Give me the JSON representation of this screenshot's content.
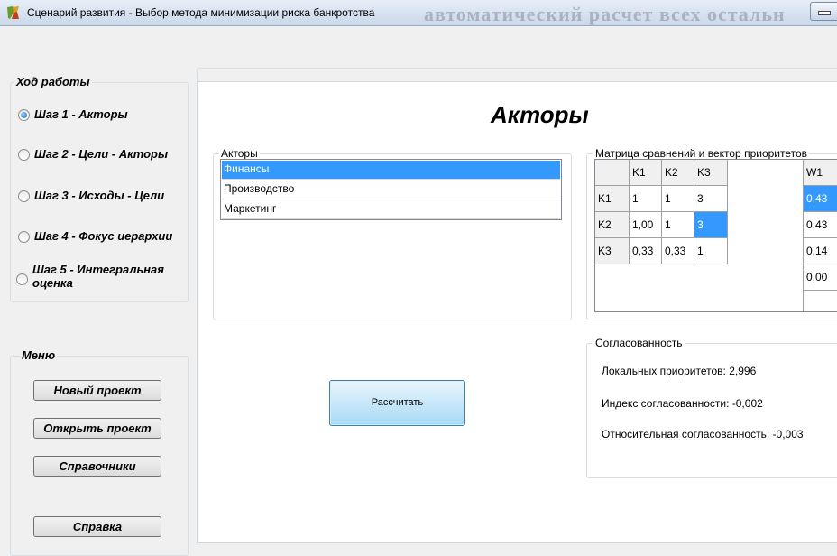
{
  "window": {
    "title": "Сценарий развития - Выбор метода минимизации риска банкротства",
    "ghost_text": "автоматический расчет всех остальн"
  },
  "workflow": {
    "legend": "Ход работы",
    "steps": [
      {
        "label": "Шаг 1 - Акторы",
        "checked": true
      },
      {
        "label": "Шаг 2 - Цели - Акторы",
        "checked": false
      },
      {
        "label": "Шаг 3 - Исходы - Цели",
        "checked": false
      },
      {
        "label": "Шаг 4 - Фокус иерархии",
        "checked": false
      },
      {
        "label": "Шаг 5 - Интегральная оценка",
        "checked": false
      }
    ]
  },
  "menu": {
    "legend": "Меню",
    "new_project": "Новый проект",
    "open_project": "Открыть проект",
    "references": "Справочники",
    "help": "Справка"
  },
  "main": {
    "title": "Акторы",
    "actors": {
      "legend": "Акторы",
      "items": [
        "Финансы",
        "Производство",
        "Маркетинг"
      ],
      "selected_index": 0
    },
    "matrix": {
      "legend": "Матрица сравнений  и вектор приоритетов",
      "columns": [
        "K1",
        "K2",
        "K3"
      ],
      "rows": [
        {
          "label": "K1",
          "values": [
            "1",
            "1",
            "3"
          ]
        },
        {
          "label": "K2",
          "values": [
            "1,00",
            "1",
            "3"
          ]
        },
        {
          "label": "K3",
          "values": [
            "0,33",
            "0,33",
            "1"
          ]
        }
      ],
      "weights_header": "W1",
      "weights": [
        "0,43",
        "0,43",
        "0,14",
        "0,00"
      ]
    },
    "calculate_button": "Рассчитать",
    "consistency": {
      "legend": "Согласованность",
      "local_priorities": "Локальных приоритетов: 2,996",
      "consistency_index": "Индекс согласованности: -0,002",
      "relative_consistency": "Относительная согласованность: -0,003"
    }
  }
}
